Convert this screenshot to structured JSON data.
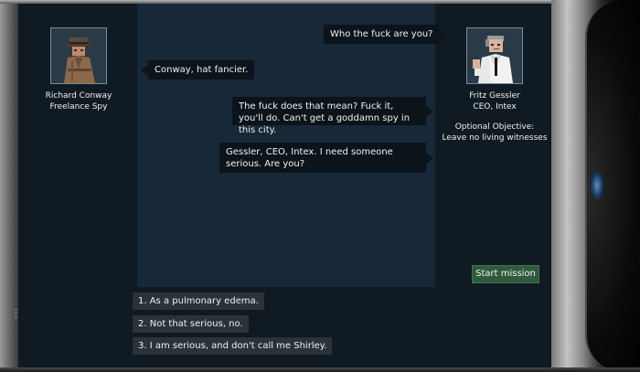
{
  "speakers": {
    "left": {
      "name": "Richard Conway",
      "title": "Freelance Spy",
      "icon": "spy-portrait-icon"
    },
    "right": {
      "name": "Fritz Gessler",
      "title": "CEO, Intex",
      "icon": "ceo-portrait-icon",
      "objective_label": "Optional Objective:",
      "objective_text": "Leave no living witnesses"
    }
  },
  "dialogue": [
    {
      "side": "right",
      "text": "Who the fuck are you?"
    },
    {
      "side": "left",
      "text": "Conway, hat fancier."
    },
    {
      "side": "right",
      "text": "The fuck does that mean? Fuck it, you'll do. Can't get a goddamn spy in this city."
    },
    {
      "side": "right",
      "text": "Gessler, CEO, Intex. I need someone serious. Are you?"
    }
  ],
  "start_mission_label": "Start mission",
  "choices": [
    "1. As a pulmonary edema.",
    "2. Not that serious, no.",
    "3. I am serious, and don't call me Shirley."
  ],
  "colors": {
    "panel": "#0f1a22",
    "dialogue_area": "#172838",
    "bubble": "#0b141b",
    "choice": "#2b3238",
    "start_button": "#2f5a3c"
  }
}
